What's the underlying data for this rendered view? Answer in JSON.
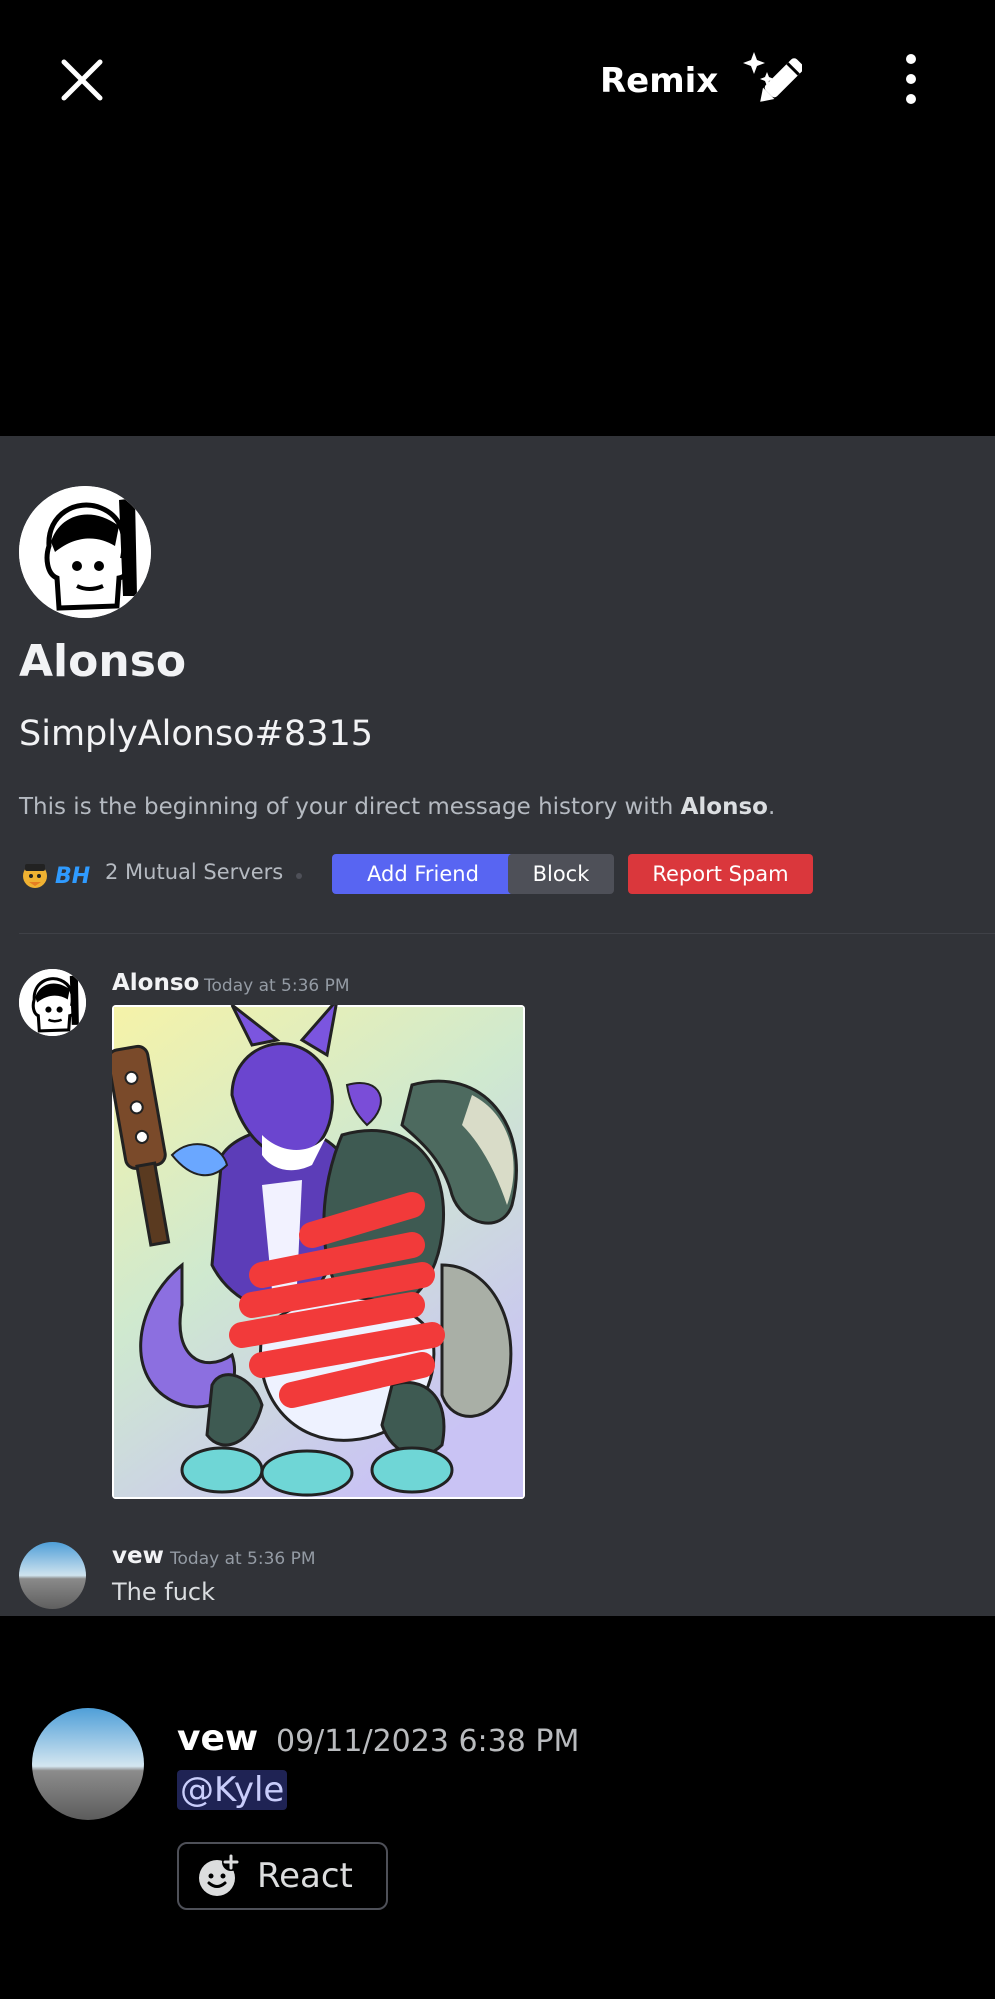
{
  "topbar": {
    "close_icon": "close-icon",
    "remix_label": "Remix",
    "remix_icon": "magic-pencil-icon",
    "more_icon": "more-vertical-icon"
  },
  "screenshot": {
    "profile": {
      "display_name": "Alonso",
      "tag": "SimplyAlonso#8315",
      "intro_prefix": "This is the beginning of your direct message history with ",
      "intro_name": "Alonso",
      "intro_suffix": ".",
      "server_badge": "BH",
      "mutual_servers": "2 Mutual Servers",
      "add_friend_label": "Add Friend",
      "block_label": "Block",
      "report_label": "Report Spam"
    },
    "messages": [
      {
        "author": "Alonso",
        "timestamp": "Today at 5:36 PM",
        "attachment": "image"
      },
      {
        "author": "vew",
        "timestamp": "Today at 5:36 PM",
        "text": "The fuck"
      }
    ]
  },
  "footer": {
    "author": "vew",
    "timestamp": "09/11/2023 6:38 PM",
    "mention": "@Kyle",
    "react_label": "React"
  },
  "colors": {
    "background": "#000000",
    "chat_background": "#313338",
    "blurple": "#5865f2",
    "grey_button": "#4e5058",
    "danger": "#da373c"
  }
}
